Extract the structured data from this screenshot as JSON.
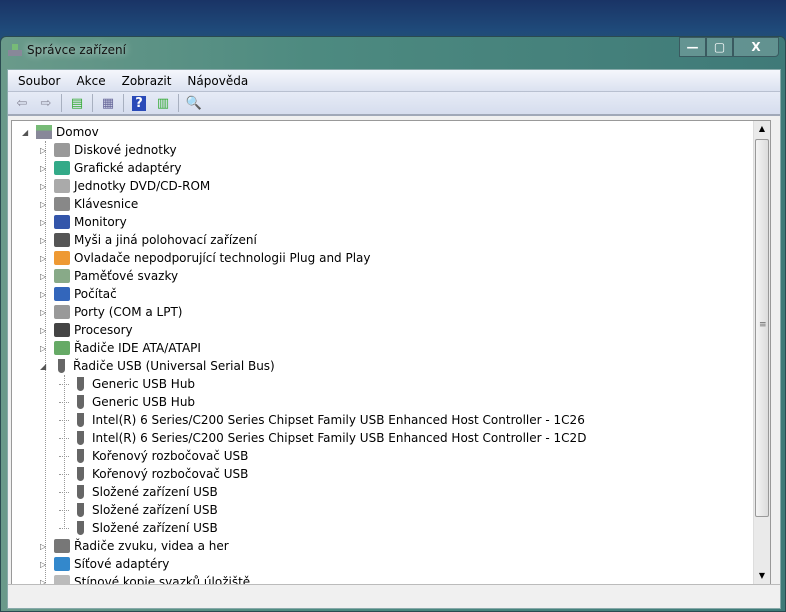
{
  "window": {
    "title": "Správce zařízení",
    "minimize": "—",
    "maximize": "▢",
    "close": "X"
  },
  "menu": [
    "Soubor",
    "Akce",
    "Zobrazit",
    "Nápověda"
  ],
  "toolbar": [
    "back-icon",
    "forward-icon",
    "show-hide-tree-icon",
    "properties-icon",
    "help-icon",
    "action-pane-icon",
    "scan-hardware-icon"
  ],
  "tree": {
    "root": "Domov",
    "items": [
      {
        "label": "Diskové jednotky",
        "level": 1,
        "state": "collapsed",
        "icon": "disk-icon"
      },
      {
        "label": "Grafické adaptéry",
        "level": 1,
        "state": "collapsed",
        "icon": "display-adapter-icon"
      },
      {
        "label": "Jednotky DVD/CD-ROM",
        "level": 1,
        "state": "collapsed",
        "icon": "dvd-icon"
      },
      {
        "label": "Klávesnice",
        "level": 1,
        "state": "collapsed",
        "icon": "keyboard-icon"
      },
      {
        "label": "Monitory",
        "level": 1,
        "state": "collapsed",
        "icon": "monitor-icon"
      },
      {
        "label": "Myši a jiná polohovací zařízení",
        "level": 1,
        "state": "collapsed",
        "icon": "mouse-icon"
      },
      {
        "label": "Ovladače nepodporující technologii Plug and Play",
        "level": 1,
        "state": "collapsed",
        "icon": "driver-icon"
      },
      {
        "label": "Paměťové svazky",
        "level": 1,
        "state": "collapsed",
        "icon": "volume-icon"
      },
      {
        "label": "Počítač",
        "level": 1,
        "state": "collapsed",
        "icon": "computer-icon"
      },
      {
        "label": "Porty (COM a LPT)",
        "level": 1,
        "state": "collapsed",
        "icon": "port-icon"
      },
      {
        "label": "Procesory",
        "level": 1,
        "state": "collapsed",
        "icon": "processor-icon"
      },
      {
        "label": "Řadiče IDE ATA/ATAPI",
        "level": 1,
        "state": "collapsed",
        "icon": "ide-icon"
      },
      {
        "label": "Řadiče USB (Universal Serial Bus)",
        "level": 1,
        "state": "expanded",
        "icon": "usb-icon"
      },
      {
        "label": "Generic USB Hub",
        "level": 2,
        "icon": "usb-icon"
      },
      {
        "label": "Generic USB Hub",
        "level": 2,
        "icon": "usb-icon"
      },
      {
        "label": "Intel(R) 6 Series/C200 Series Chipset Family USB Enhanced Host Controller - 1C26",
        "level": 2,
        "icon": "usb-icon"
      },
      {
        "label": "Intel(R) 6 Series/C200 Series Chipset Family USB Enhanced Host Controller - 1C2D",
        "level": 2,
        "icon": "usb-icon"
      },
      {
        "label": "Kořenový rozbočovač USB",
        "level": 2,
        "icon": "usb-icon"
      },
      {
        "label": "Kořenový rozbočovač USB",
        "level": 2,
        "icon": "usb-icon"
      },
      {
        "label": "Složené zařízení USB",
        "level": 2,
        "icon": "usb-icon"
      },
      {
        "label": "Složené zařízení USB",
        "level": 2,
        "icon": "usb-icon"
      },
      {
        "label": "Složené zařízení USB",
        "level": 2,
        "icon": "usb-icon"
      },
      {
        "label": "Řadiče zvuku, videa a her",
        "level": 1,
        "state": "collapsed",
        "icon": "speaker-icon"
      },
      {
        "label": "Síťové adaptéry",
        "level": 1,
        "state": "collapsed",
        "icon": "network-icon"
      },
      {
        "label": "Stínové kopie svazků úložiště",
        "level": 1,
        "state": "collapsed",
        "icon": "shadow-copy-icon"
      }
    ]
  },
  "scrollbar": {
    "up": "▲",
    "down": "▼",
    "grip": "≡"
  }
}
